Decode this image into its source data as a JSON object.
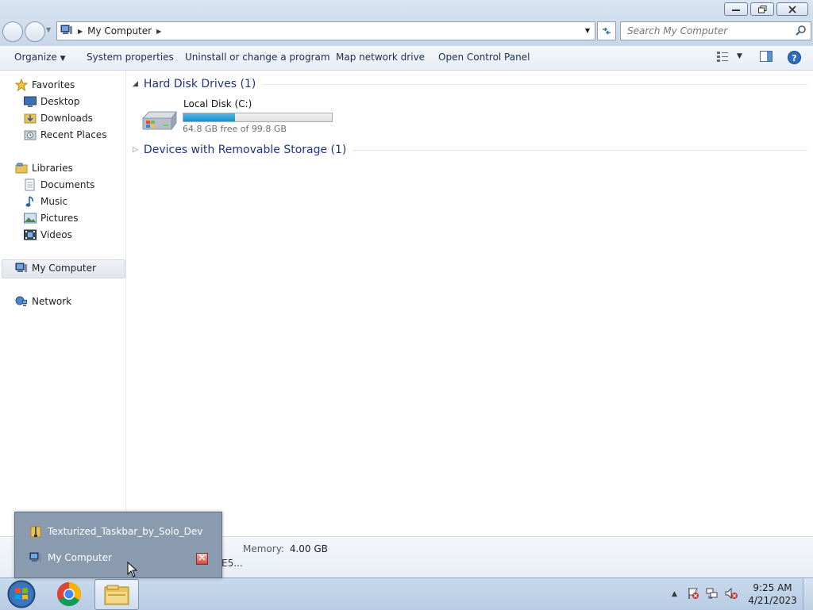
{
  "window": {
    "minimize_icon": "minimize-icon",
    "restore_icon": "restore-icon",
    "close_icon": "close-icon"
  },
  "address_bar": {
    "path": "My Computer",
    "search_placeholder": "Search My Computer"
  },
  "toolbar": {
    "organize": "Organize",
    "system_properties": "System properties",
    "uninstall": "Uninstall or change a program",
    "map_network_drive": "Map network drive",
    "open_control_panel": "Open Control Panel"
  },
  "nav": {
    "favorites": "Favorites",
    "desktop": "Desktop",
    "downloads": "Downloads",
    "recent_places": "Recent Places",
    "libraries": "Libraries",
    "documents": "Documents",
    "music": "Music",
    "pictures": "Pictures",
    "videos": "Videos",
    "my_computer": "My Computer",
    "network": "Network"
  },
  "content": {
    "hard_disk_group": "Hard Disk Drives (1)",
    "drive_name": "Local Disk (C:)",
    "drive_free": "64.8 GB free of 99.8 GB",
    "drive_used_fraction": 0.35,
    "removable_group": "Devices with Removable Storage (1)"
  },
  "details": {
    "memory_label": "Memory:",
    "memory_value": "4.00 GB",
    "cpu_fragment": "E5..."
  },
  "popup": {
    "item1": "Texturized_Taskbar_by_Solo_Dev",
    "item2": "My Computer"
  },
  "taskbar": {
    "time": "9:25 AM",
    "date": "4/21/2023"
  },
  "colors": {
    "accent": "#1e3287",
    "drive_fill": "#1f8fc7",
    "taskbar": "#b7cce4"
  }
}
